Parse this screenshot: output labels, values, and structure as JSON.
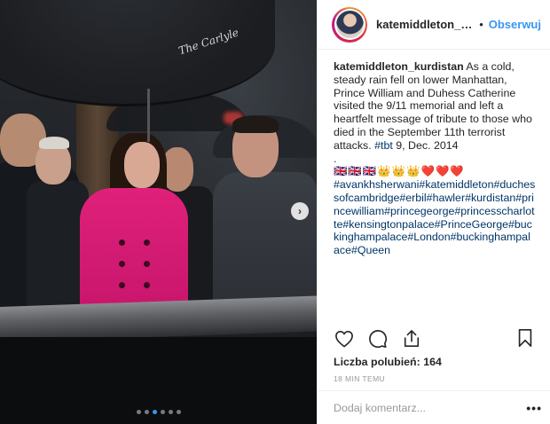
{
  "post": {
    "username": "katemiddleton_kurdi...",
    "follow_separator": "•",
    "follow_label": "Obserwuj",
    "caption": {
      "username": "katemiddleton_kurdistan",
      "text": "As a cold, steady rain fell on lower Manhattan, Prince William and Duhess Catherine visited the 9/11 memorial and left a heartfelt message of tribute to those who died in the September 11th terrorist attacks.",
      "tbt": "#tbt",
      "date": "9, Dec. 2014",
      "dot": ".",
      "emojis": "🇬🇧🇬🇧🇬🇧👑👑👑❤️❤️❤️",
      "hashtags": "#avankhsherwani#katemiddleton#duchessofcambridge#erbil#hawler#kurdistan#princewilliam#princegeorge#princesscharlotte#kensingtonpalace#PrinceGeorge#buckinghampalace#London#buckinghampalace#Queen"
    },
    "likes_label": "Liczba polubień: 164",
    "time_label": "18 MIN TEMU",
    "comment_placeholder": "Dodaj komentarz...",
    "more_label": "•••",
    "umbrella_text": "The Carlyle"
  },
  "carousel": {
    "slides": 6,
    "active_index": 2
  },
  "colors": {
    "accent": "#3897f0",
    "hashtag": "#003569",
    "coat": "#e0207a"
  },
  "icons": [
    "heart-icon",
    "comment-icon",
    "share-icon",
    "bookmark-icon",
    "chevron-right-icon",
    "more-options-icon"
  ]
}
